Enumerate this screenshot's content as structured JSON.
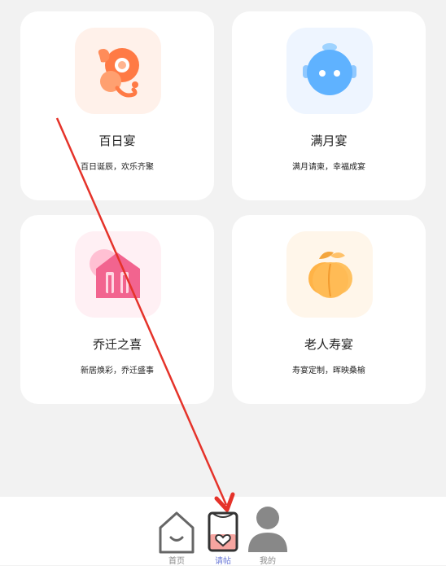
{
  "cards": [
    {
      "title": "百日宴",
      "subtitle": "百日诞辰，欢乐齐聚",
      "icon": "baby-rattle-icon"
    },
    {
      "title": "满月宴",
      "subtitle": "满月请柬，幸福成宴",
      "icon": "baby-face-icon"
    },
    {
      "title": "乔迁之喜",
      "subtitle": "新居焕彩，乔迁盛事",
      "icon": "house-icon"
    },
    {
      "title": "老人寿宴",
      "subtitle": "寿宴定制，晖映桑榆",
      "icon": "peach-icon"
    }
  ],
  "tabbar": {
    "items": [
      {
        "label": "首页",
        "icon": "home-icon",
        "active": false
      },
      {
        "label": "请帖",
        "icon": "invitation-icon",
        "active": true
      },
      {
        "label": "我的",
        "icon": "profile-icon",
        "active": false
      }
    ]
  },
  "colors": {
    "annotation_arrow": "#e5332a",
    "active_tab": "#6c7bd8",
    "background": "#f2f2f2"
  }
}
